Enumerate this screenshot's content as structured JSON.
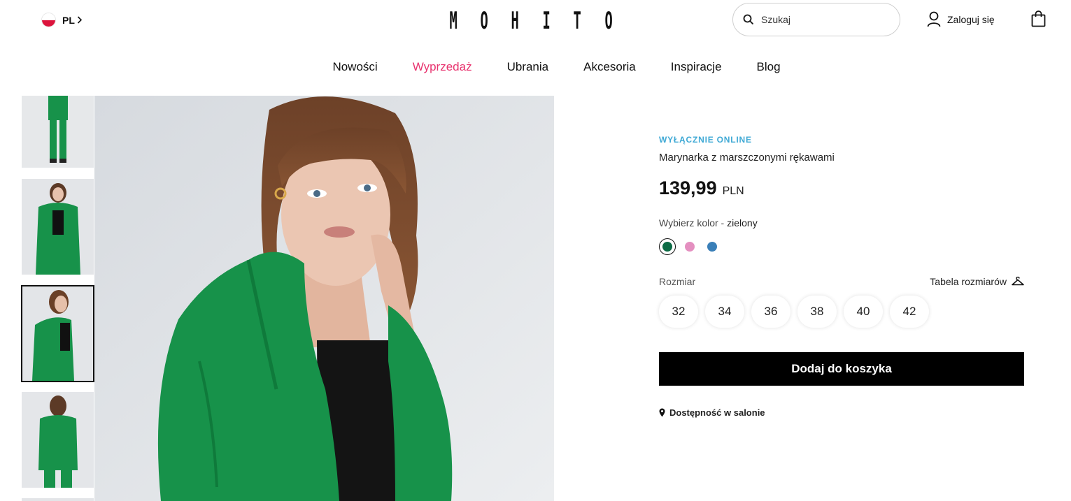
{
  "header": {
    "locale": "PL",
    "logo": "MOHITO",
    "search_placeholder": "Szukaj",
    "login_label": "Zaloguj się"
  },
  "nav": {
    "items": [
      {
        "label": "Nowości"
      },
      {
        "label": "Wyprzedaż",
        "color": "#e8346f"
      },
      {
        "label": "Ubrania"
      },
      {
        "label": "Akcesoria"
      },
      {
        "label": "Inspiracje"
      },
      {
        "label": "Blog"
      }
    ]
  },
  "gallery": {
    "active_thumb": 2,
    "jacket_color": "#17924a"
  },
  "product": {
    "badge": "WYŁĄCZNIE ONLINE",
    "badge_color": "#3fa9d5",
    "title": "Marynarka z marszczonymi rękawami",
    "price": "139,99",
    "currency": "PLN",
    "color_label": "Wybierz kolor -",
    "color_value": "zielony",
    "colors": [
      {
        "name": "zielony",
        "hex": "#0c6b45",
        "selected": true
      },
      {
        "name": "różowy",
        "hex": "#e48fc0",
        "selected": false
      },
      {
        "name": "niebieski",
        "hex": "#3a7fb8",
        "selected": false
      }
    ],
    "size_label": "Rozmiar",
    "size_table_label": "Tabela rozmiarów",
    "sizes": [
      "32",
      "34",
      "36",
      "38",
      "40",
      "42"
    ],
    "add_to_cart": "Dodaj do koszyka",
    "availability": "Dostępność w salonie"
  }
}
